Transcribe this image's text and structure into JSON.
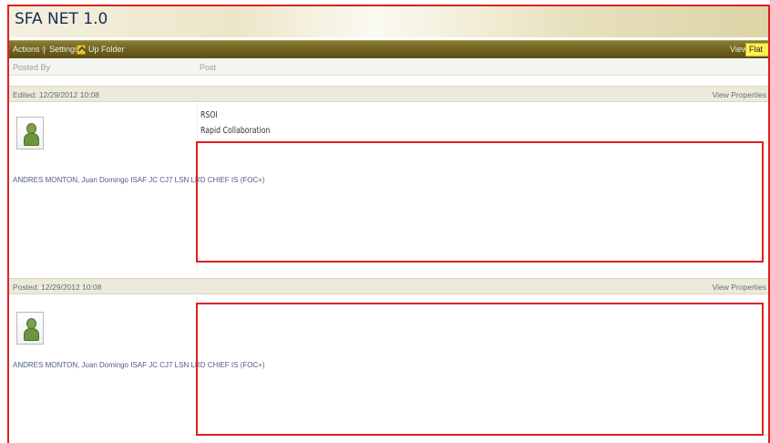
{
  "app": {
    "title": "SFA NET 1.0"
  },
  "toolbar": {
    "actions_label": "Actions",
    "settings_label": "Settings",
    "up_folder_label": "Up Folder",
    "view_label": "View:",
    "view_value": "Flat"
  },
  "columns": {
    "posted_by": "Posted By",
    "post": "Post"
  },
  "posts": [
    {
      "stamp": "Edited: 12/29/2012 10:08",
      "view_properties": "View Properties",
      "author": "ANDRES MONTON, Juan Domingo ISAF JC CJ7 LSN LRD CHIEF IS (FOC+)",
      "lines": [
        "RSOI",
        "Rapid Collaboration"
      ]
    },
    {
      "stamp": "Posted: 12/29/2012 10:08",
      "view_properties": "View Properties",
      "author": "ANDRES MONTON, Juan Domingo ISAF JC CJ7 LSN LRD CHIEF IS (FOC+)",
      "lines": []
    }
  ],
  "colors": {
    "highlight": "#e02020",
    "toolbar": "#6b5f1f",
    "view_select": "#fff14f"
  }
}
